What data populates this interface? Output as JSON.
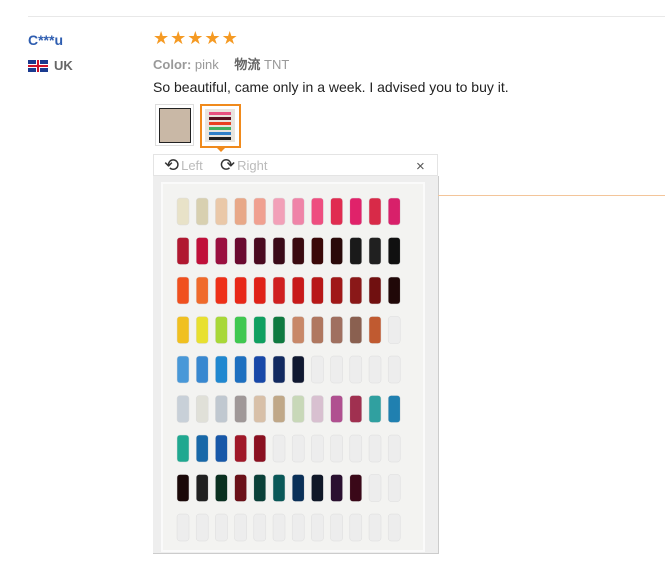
{
  "reviewer": {
    "name": "C***u",
    "country_code": "UK"
  },
  "rating": {
    "stars": 5,
    "max": 5
  },
  "attributes": {
    "color_label": "Color:",
    "color_value": "pink",
    "shipping_label": "物流",
    "shipping_value": "TNT"
  },
  "review_text": "So beautiful, came only in a week. I advised you to buy it.",
  "viewer": {
    "left_label": "Left",
    "right_label": "Right",
    "close_symbol": "×"
  },
  "colors": {
    "name": "#2e5db0",
    "star": "#f59a23",
    "selected_border": "#f08a1c"
  },
  "swatch_rows": [
    [
      "#e8e2c8",
      "#d8d0b0",
      "#eac8a8",
      "#e8a888",
      "#f0a090",
      "#f2a0b8",
      "#ef84a8",
      "#ee4e80",
      "#e02c50",
      "#e0226a",
      "#d82a48",
      "#d8206a"
    ],
    [
      "#b01830",
      "#c0103a",
      "#9a1040",
      "#6a0a30",
      "#4a0a20",
      "#3a0a18",
      "#3a0a10",
      "#3a0808",
      "#2a0a0a",
      "#1a1a1a",
      "#202020",
      "#101010"
    ],
    [
      "#f0501e",
      "#f06a2a",
      "#ee3018",
      "#e82818",
      "#e02218",
      "#d02020",
      "#c81a1a",
      "#b81818",
      "#a01818",
      "#8a1818",
      "#701010",
      "#200808"
    ],
    [
      "#f0c020",
      "#e8e030",
      "#a8d838",
      "#40c850",
      "#10a060",
      "#107a40",
      "#c88868",
      "#b07860",
      "#a07060",
      "#8a6050",
      "#c05a30",
      "#ededed"
    ],
    [
      "#4898d8",
      "#3888d0",
      "#2088d0",
      "#1e70c0",
      "#1848a8",
      "#122a60",
      "#101830",
      "#ededed",
      "#ededed",
      "#ededed",
      "#ededed",
      "#ededed"
    ],
    [
      "#c8d0d8",
      "#e0e0d8",
      "#c0c8d0",
      "#a09898",
      "#d8c0a8",
      "#c0a888",
      "#c8d8b8",
      "#d8c0d0",
      "#b05090",
      "#a03050",
      "#30a0a0",
      "#2080b0"
    ],
    [
      "#20a890",
      "#1868a8",
      "#1858a8",
      "#a01828",
      "#8a1020",
      "#ededed",
      "#ededed",
      "#ededed",
      "#ededed",
      "#ededed",
      "#ededed",
      "#ededed"
    ],
    [
      "#1a0808",
      "#202020",
      "#0a3020",
      "#6a1018",
      "#0a4038",
      "#0a5858",
      "#0a3058",
      "#101828",
      "#2a1030",
      "#3a0818",
      "#ededed",
      "#ededed"
    ],
    [
      "#ededed",
      "#ededed",
      "#ededed",
      "#ededed",
      "#ededed",
      "#ededed",
      "#ededed",
      "#ededed",
      "#ededed",
      "#ededed",
      "#ededed",
      "#ededed"
    ]
  ]
}
